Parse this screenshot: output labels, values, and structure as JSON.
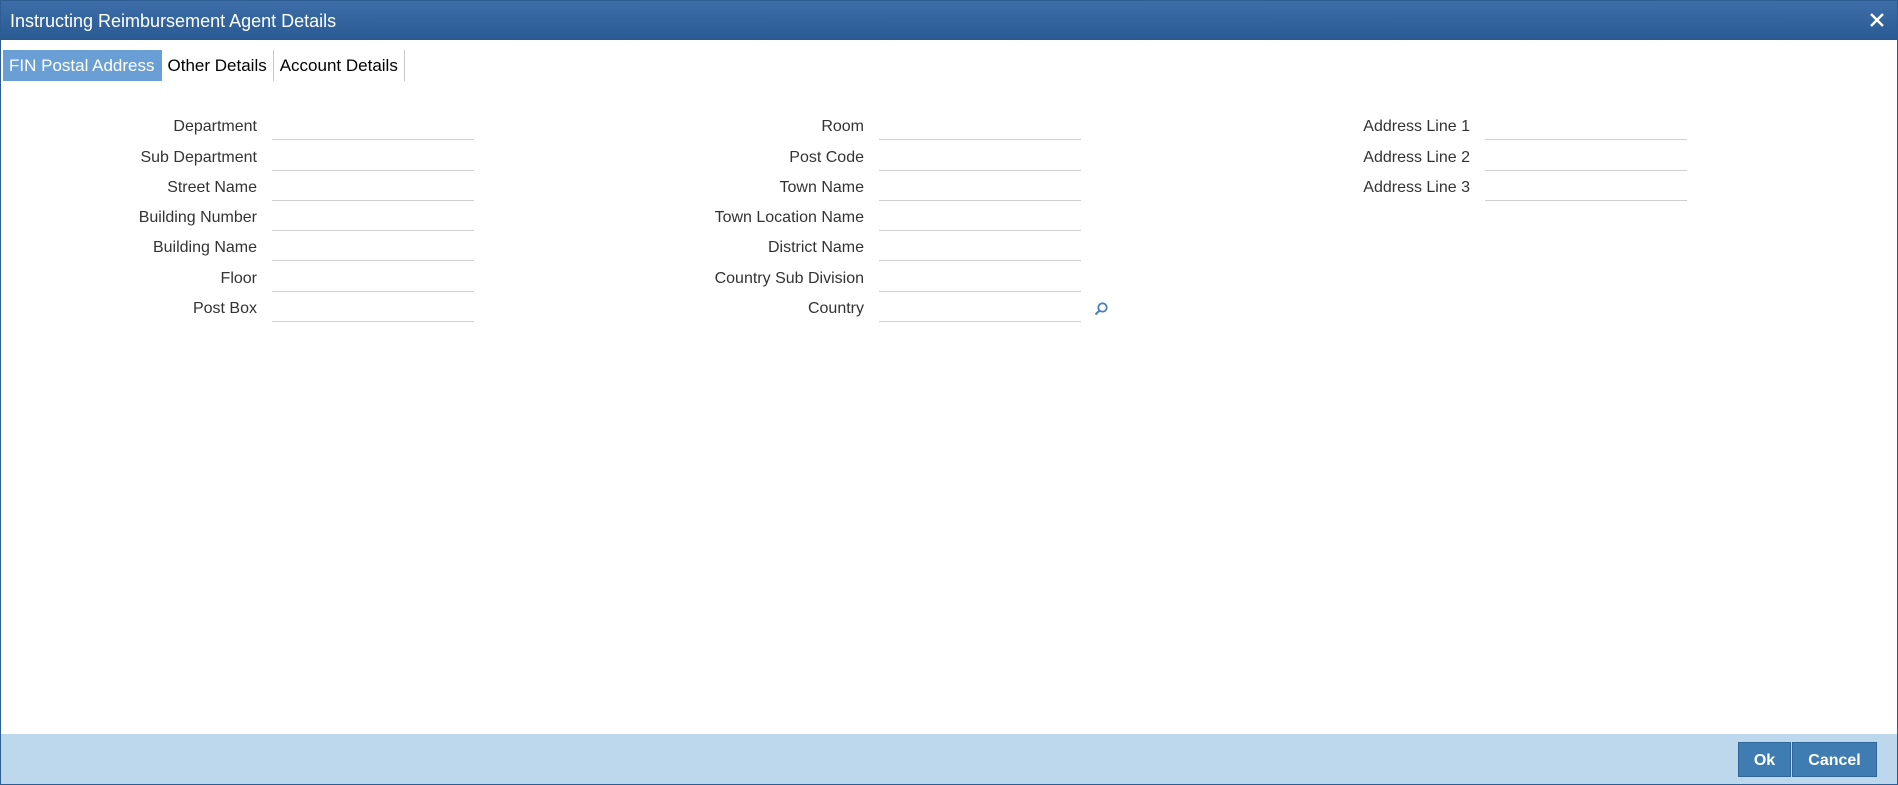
{
  "window": {
    "title": "Instructing Reimbursement Agent Details"
  },
  "tabs": [
    {
      "label": "FIN Postal Address",
      "active": true
    },
    {
      "label": "Other Details",
      "active": false
    },
    {
      "label": "Account Details",
      "active": false
    }
  ],
  "columns": {
    "left": [
      {
        "label": "Department",
        "value": ""
      },
      {
        "label": "Sub Department",
        "value": ""
      },
      {
        "label": "Street Name",
        "value": ""
      },
      {
        "label": "Building Number",
        "value": ""
      },
      {
        "label": "Building Name",
        "value": ""
      },
      {
        "label": "Floor",
        "value": ""
      },
      {
        "label": "Post Box",
        "value": ""
      }
    ],
    "middle": [
      {
        "label": "Room",
        "value": ""
      },
      {
        "label": "Post Code",
        "value": ""
      },
      {
        "label": "Town Name",
        "value": ""
      },
      {
        "label": "Town Location Name",
        "value": ""
      },
      {
        "label": "District Name",
        "value": ""
      },
      {
        "label": "Country Sub Division",
        "value": ""
      },
      {
        "label": "Country",
        "value": "",
        "has_lookup": true
      }
    ],
    "right": [
      {
        "label": "Address Line 1",
        "value": ""
      },
      {
        "label": "Address Line 2",
        "value": ""
      },
      {
        "label": "Address Line 3",
        "value": ""
      }
    ]
  },
  "footer": {
    "ok_label": "Ok",
    "cancel_label": "Cancel"
  },
  "icons": {
    "close": "close-icon",
    "lookup": "search-icon"
  },
  "colors": {
    "titlebar": "#2f5f97",
    "active_tab": "#6a9fd6",
    "footer": "#bdd8ec",
    "button": "#3f7cb1"
  }
}
